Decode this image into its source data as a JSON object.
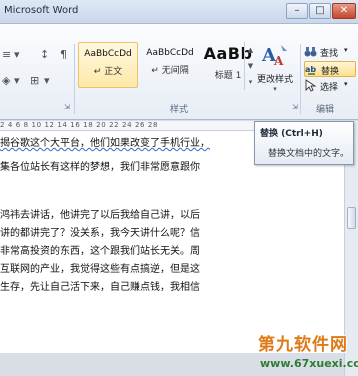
{
  "window": {
    "title": "Microsoft Word",
    "min_glyph": "–",
    "max_glyph": "□",
    "close_glyph": "✕"
  },
  "ribbon": {
    "styles_group": {
      "label": "样式",
      "styles": [
        {
          "preview": "AaBbCcDd",
          "name": "↵ 正文",
          "selected": true
        },
        {
          "preview": "AaBbCcDd",
          "name": "↵ 无间隔",
          "selected": false
        },
        {
          "preview": "AaBb",
          "name": "标题 1",
          "selected": false
        }
      ],
      "change_styles_label": "更改样式"
    },
    "editing_group": {
      "label": "编辑",
      "find_label": "查找",
      "replace_label": "替换",
      "select_label": "选择"
    },
    "icons": {
      "find": "binoculars-icon",
      "replace": "replace-icon",
      "select": "cursor-select-icon",
      "change_styles": "change-styles-icon"
    },
    "accent_colors": {
      "selected_tile": "#fde9a8",
      "active_button": "#fddf8c"
    }
  },
  "tooltip": {
    "title": "替换 (Ctrl+H)",
    "description": "替换文档中的文字。"
  },
  "ruler": {
    "text": "2  4  6  8  10  12  14  16  18  20  22  24  26  28"
  },
  "document": {
    "lines": [
      {
        "text": "揭谷歌这个大平台，他们如果改变了手机行业，",
        "squiggle": true
      },
      {
        "text": "集各位站长有这样的梦想，我们非常愿意跟你",
        "squiggle": false
      },
      {
        "text": "",
        "squiggle": false
      },
      {
        "text": "",
        "squiggle": false
      },
      {
        "text": "鸿祎去讲话，他讲完了以后我给自己讲，以后",
        "squiggle": false
      },
      {
        "text": "讲的都讲完了？没关系，我今天讲什么呢？信",
        "squiggle": false
      },
      {
        "text": "非常高投资的东西，这个跟我们站长无关。周",
        "squiggle": false
      },
      {
        "text": "互联网的产业，我觉得这些有点搞逆，但是这",
        "squiggle": false
      },
      {
        "text": "生存，先让自己活下来，自己赚点钱，我相信",
        "squiggle": false
      }
    ]
  },
  "watermark": {
    "brand": "第九软件网",
    "url": "www.67xuexi.com"
  }
}
